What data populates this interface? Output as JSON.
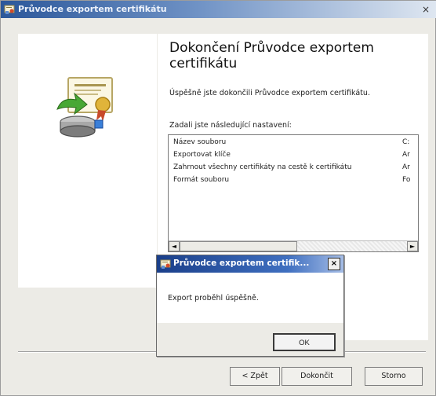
{
  "wizard": {
    "title": "Průvodce exportem certifikátu",
    "heading": "Dokončení Průvodce exportem certifikátu",
    "success_text": "Úspěšně jste dokončili Průvodce exportem certifikátu.",
    "settings_label": "Zadali jste následující nastavení:",
    "settings": [
      {
        "name": "Název souboru",
        "value": "C:"
      },
      {
        "name": "Exportovat klíče",
        "value": "Ar"
      },
      {
        "name": "Zahrnout všechny certifikáty na cestě k certifikátu",
        "value": "Ar"
      },
      {
        "name": "Formát souboru",
        "value": "Fo"
      }
    ],
    "buttons": {
      "back": "< Zpět",
      "finish": "Dokončit",
      "cancel": "Storno"
    },
    "close_glyph": "×"
  },
  "message_box": {
    "title": "Průvodce exportem certifik...",
    "text": "Export proběhl úspěšně.",
    "ok_label": "OK",
    "close_glyph": "×"
  },
  "scroll": {
    "left_arrow": "◄",
    "right_arrow": "►"
  },
  "colors": {
    "title_bar": "#2b579a",
    "dialog_title_bar": "#1a3f8a",
    "window_bg": "#ecebe6"
  },
  "icons": [
    "certificate-wizard-icon",
    "certificate-export-icon",
    "close-icon",
    "scroll-left-icon",
    "scroll-right-icon"
  ]
}
